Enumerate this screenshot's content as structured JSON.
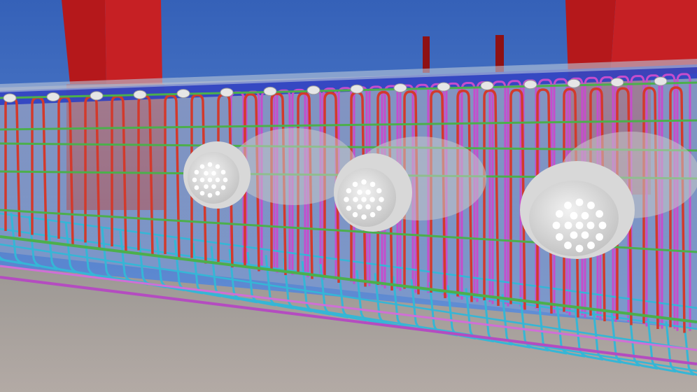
{
  "scene": {
    "subject": "bim-rebar-model-render",
    "colors": {
      "sky_top": "#3561b8",
      "sky_bottom": "#5f8ed6",
      "column": "#b5181b",
      "column_dark": "#7e0d10",
      "deck_blue": "#2c3fc2",
      "stirrup_red": "#d23a2c",
      "stirrup_magenta": "#c64dcc",
      "bar_cyan": "#35b6d6",
      "bar_green": "#4caf4c",
      "floor": "#a8a09b",
      "anchor_white": "#e6e6e6"
    }
  }
}
